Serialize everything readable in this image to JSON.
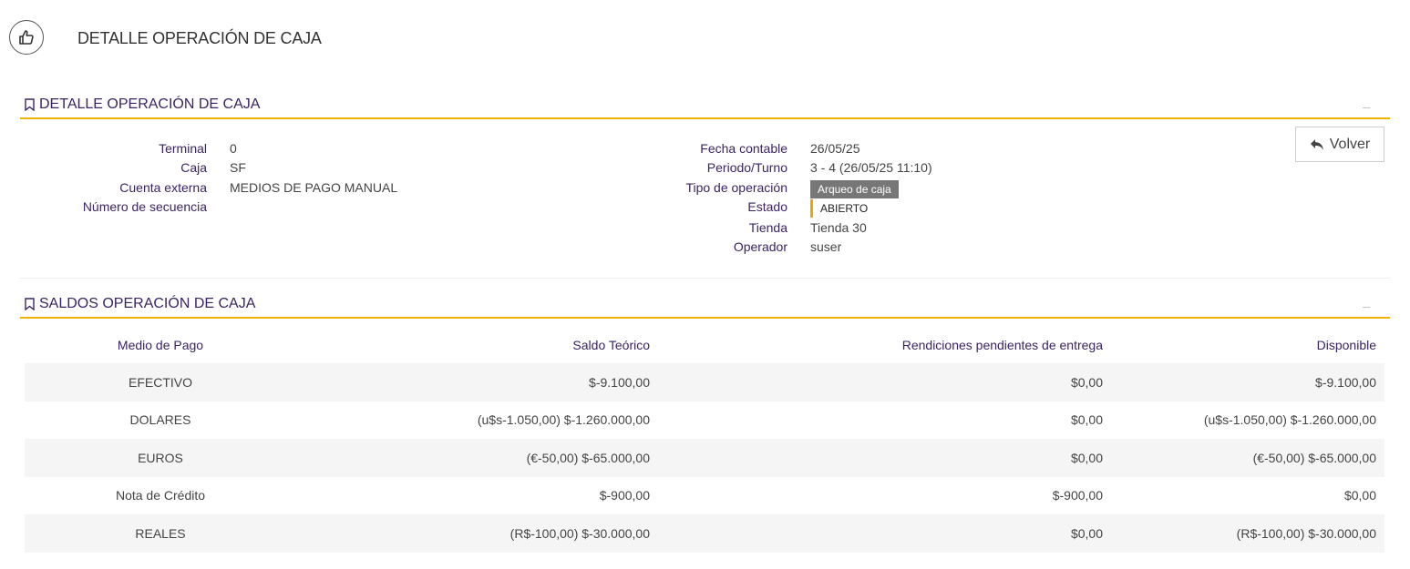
{
  "page": {
    "title": "DETALLE OPERACIÓN DE CAJA",
    "icon": "thumbs-up-icon"
  },
  "detalle": {
    "section_title": "DETALLE OPERACIÓN DE CAJA",
    "collapse_label": "_",
    "fields_left": [
      {
        "label": "Terminal",
        "value": "0"
      },
      {
        "label": "Caja",
        "value": "SF"
      },
      {
        "label": "Cuenta externa",
        "value": "MEDIOS DE PAGO MANUAL"
      },
      {
        "label": "Número de secuencia",
        "value": ""
      }
    ],
    "fields_right": {
      "fecha_contable": {
        "label": "Fecha contable",
        "value": "26/05/25"
      },
      "periodo_turno": {
        "label": "Periodo/Turno",
        "value": "3 - 4 (26/05/25 11:10)"
      },
      "tipo_operacion": {
        "label": "Tipo de operación",
        "value": "Arqueo de caja"
      },
      "estado": {
        "label": "Estado",
        "value": "ABIERTO"
      },
      "tienda": {
        "label": "Tienda",
        "value": "Tienda 30"
      },
      "operador": {
        "label": "Operador",
        "value": "suser"
      }
    },
    "volver_label": "Volver"
  },
  "saldos": {
    "section_title": "SALDOS OPERACIÓN DE CAJA",
    "collapse_label": "_",
    "columns": [
      "Medio de Pago",
      "Saldo Teórico",
      "Rendiciones pendientes de entrega",
      "Disponible"
    ],
    "rows": [
      [
        "EFECTIVO",
        "$-9.100,00",
        "$0,00",
        "$-9.100,00"
      ],
      [
        "DOLARES",
        "(u$s-1.050,00) $-1.260.000,00",
        "$0,00",
        "(u$s-1.050,00) $-1.260.000,00"
      ],
      [
        "EUROS",
        "(€-50,00) $-65.000,00",
        "$0,00",
        "(€-50,00) $-65.000,00"
      ],
      [
        "Nota de Crédito",
        "$-900,00",
        "$-900,00",
        "$0,00"
      ],
      [
        "REALES",
        "(R$-100,00) $-30.000,00",
        "$0,00",
        "(R$-100,00) $-30.000,00"
      ]
    ]
  },
  "colors": {
    "accent": "#f0b100",
    "label": "#3a2463",
    "badge_grey": "#777777",
    "status_bar": "#f0a500"
  }
}
